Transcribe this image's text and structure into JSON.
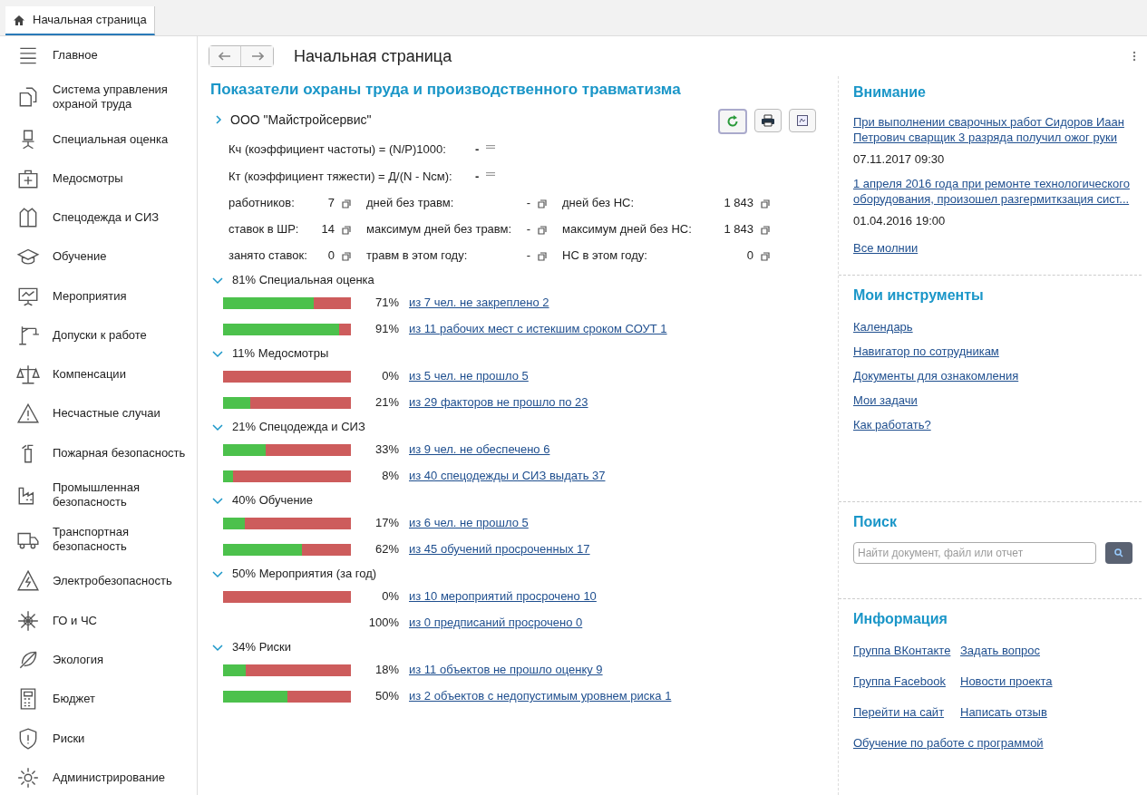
{
  "tab": {
    "label": "Начальная страница",
    "selected": true
  },
  "sidebar": {
    "items": [
      {
        "label": "Главное"
      },
      {
        "label": "Система управления охраной труда"
      },
      {
        "label": "Специальная оценка"
      },
      {
        "label": "Медосмотры"
      },
      {
        "label": "Спецодежда и СИЗ"
      },
      {
        "label": "Обучение"
      },
      {
        "label": "Мероприятия"
      },
      {
        "label": "Допуски к работе"
      },
      {
        "label": "Компенсации"
      },
      {
        "label": "Несчастные случаи"
      },
      {
        "label": "Пожарная безопасность"
      },
      {
        "label": "Промышленная безопасность"
      },
      {
        "label": "Транспортная безопасность"
      },
      {
        "label": "Электробезопасность"
      },
      {
        "label": "ГО и ЧС"
      },
      {
        "label": "Экология"
      },
      {
        "label": "Бюджет"
      },
      {
        "label": "Риски"
      },
      {
        "label": "Администрирование"
      }
    ]
  },
  "page_title": "Начальная страница",
  "dashboard": {
    "title": "Показатели охраны труда и производственного травматизма",
    "organization": {
      "name": "ООО \"Майстройсервис\"",
      "expanded": false
    },
    "coefficients": [
      {
        "label": "Кч (коэффициент частоты) = (N/P)1000:",
        "value": "-"
      },
      {
        "label": "Кт (коэффициент тяжести) = Д/(N - Nсм):",
        "value": "-"
      }
    ],
    "stats": [
      {
        "label": "работников:",
        "value": "7"
      },
      {
        "label": "дней без травм:",
        "value": "-"
      },
      {
        "label": "дней без НС:",
        "value": "1 843"
      },
      {
        "label": "ставок в ШР:",
        "value": "14"
      },
      {
        "label": "максимум дней без травм:",
        "value": "-"
      },
      {
        "label": "максимум дней без НС:",
        "value": "1 843"
      },
      {
        "label": "занято ставок:",
        "value": "0"
      },
      {
        "label": "травм в этом году:",
        "value": "-"
      },
      {
        "label": "НС в этом году:",
        "value": "0"
      }
    ],
    "sections": [
      {
        "title": "81% Специальная оценка",
        "expanded": true,
        "rows": [
          {
            "level": 0.71,
            "percent": "71%",
            "link": "из 7 чел. не закреплено 2"
          },
          {
            "level": 0.91,
            "percent": "91%",
            "link": "из 11 рабочих мест с истекшим сроком СОУТ 1"
          }
        ]
      },
      {
        "title": "11% Медосмотры",
        "expanded": true,
        "rows": [
          {
            "level": 0,
            "percent": "0%",
            "link": "из 5 чел. не прошло 5"
          },
          {
            "level": 0.21,
            "percent": "21%",
            "link": "из 29 факторов не прошло по 23"
          }
        ]
      },
      {
        "title": "21% Спецодежда и СИЗ",
        "expanded": true,
        "rows": [
          {
            "level": 0.33,
            "percent": "33%",
            "link": "из 9 чел. не обеспечено 6"
          },
          {
            "level": 0.08,
            "percent": "8%",
            "link": "из 40 спецодежды и СИЗ выдать 37"
          }
        ]
      },
      {
        "title": "40% Обучение",
        "expanded": true,
        "rows": [
          {
            "level": 0.17,
            "percent": "17%",
            "link": "из 6 чел. не прошло 5"
          },
          {
            "level": 0.62,
            "percent": "62%",
            "link": "из 45 обучений просроченных 17"
          }
        ]
      },
      {
        "title": "50% Мероприятия (за год)",
        "expanded": true,
        "rows": [
          {
            "level": 0,
            "percent": "0%",
            "link": "из 10 мероприятий просрочено 10"
          },
          {
            "percent": "100%",
            "link": "из 0 предписаний просрочено 0"
          }
        ]
      },
      {
        "title": "34% Риски",
        "expanded": true,
        "rows": [
          {
            "level": 0.18,
            "percent": "18%",
            "link": "из 11 объектов не прошло оценку 9"
          },
          {
            "level": 0.5,
            "percent": "50%",
            "link": "из 2 объектов с недопустимым уровнем риска 1"
          }
        ]
      }
    ]
  },
  "attention": {
    "title": "Внимание",
    "items": [
      {
        "link": "При выполнении сварочных работ Сидоров Иаан Петрович сварщик 3 разряда получил ожог руки",
        "date": "07.11.2017 09:30"
      },
      {
        "link": "1 апреля 2016 года при ремонте технологического оборудования, произошел разгермиткзация сист...",
        "date": "01.04.2016 19:00"
      }
    ],
    "all_link": "Все молнии"
  },
  "tools": {
    "title": "Мои инструменты",
    "links": [
      "Календарь",
      "Навигатор по сотрудникам",
      "Документы для ознакомления",
      "Мои задачи",
      "Как работать?"
    ]
  },
  "search": {
    "title": "Поиск",
    "placeholder": "Найти документ, файл или отчет"
  },
  "info": {
    "title": "Информация",
    "links": [
      "Группа ВКонтакте",
      "Задать вопрос",
      "Группа Facebook",
      "Новости проекта",
      "Перейти на сайт",
      "Написать отзыв",
      "Обучение по работе с программой"
    ]
  }
}
